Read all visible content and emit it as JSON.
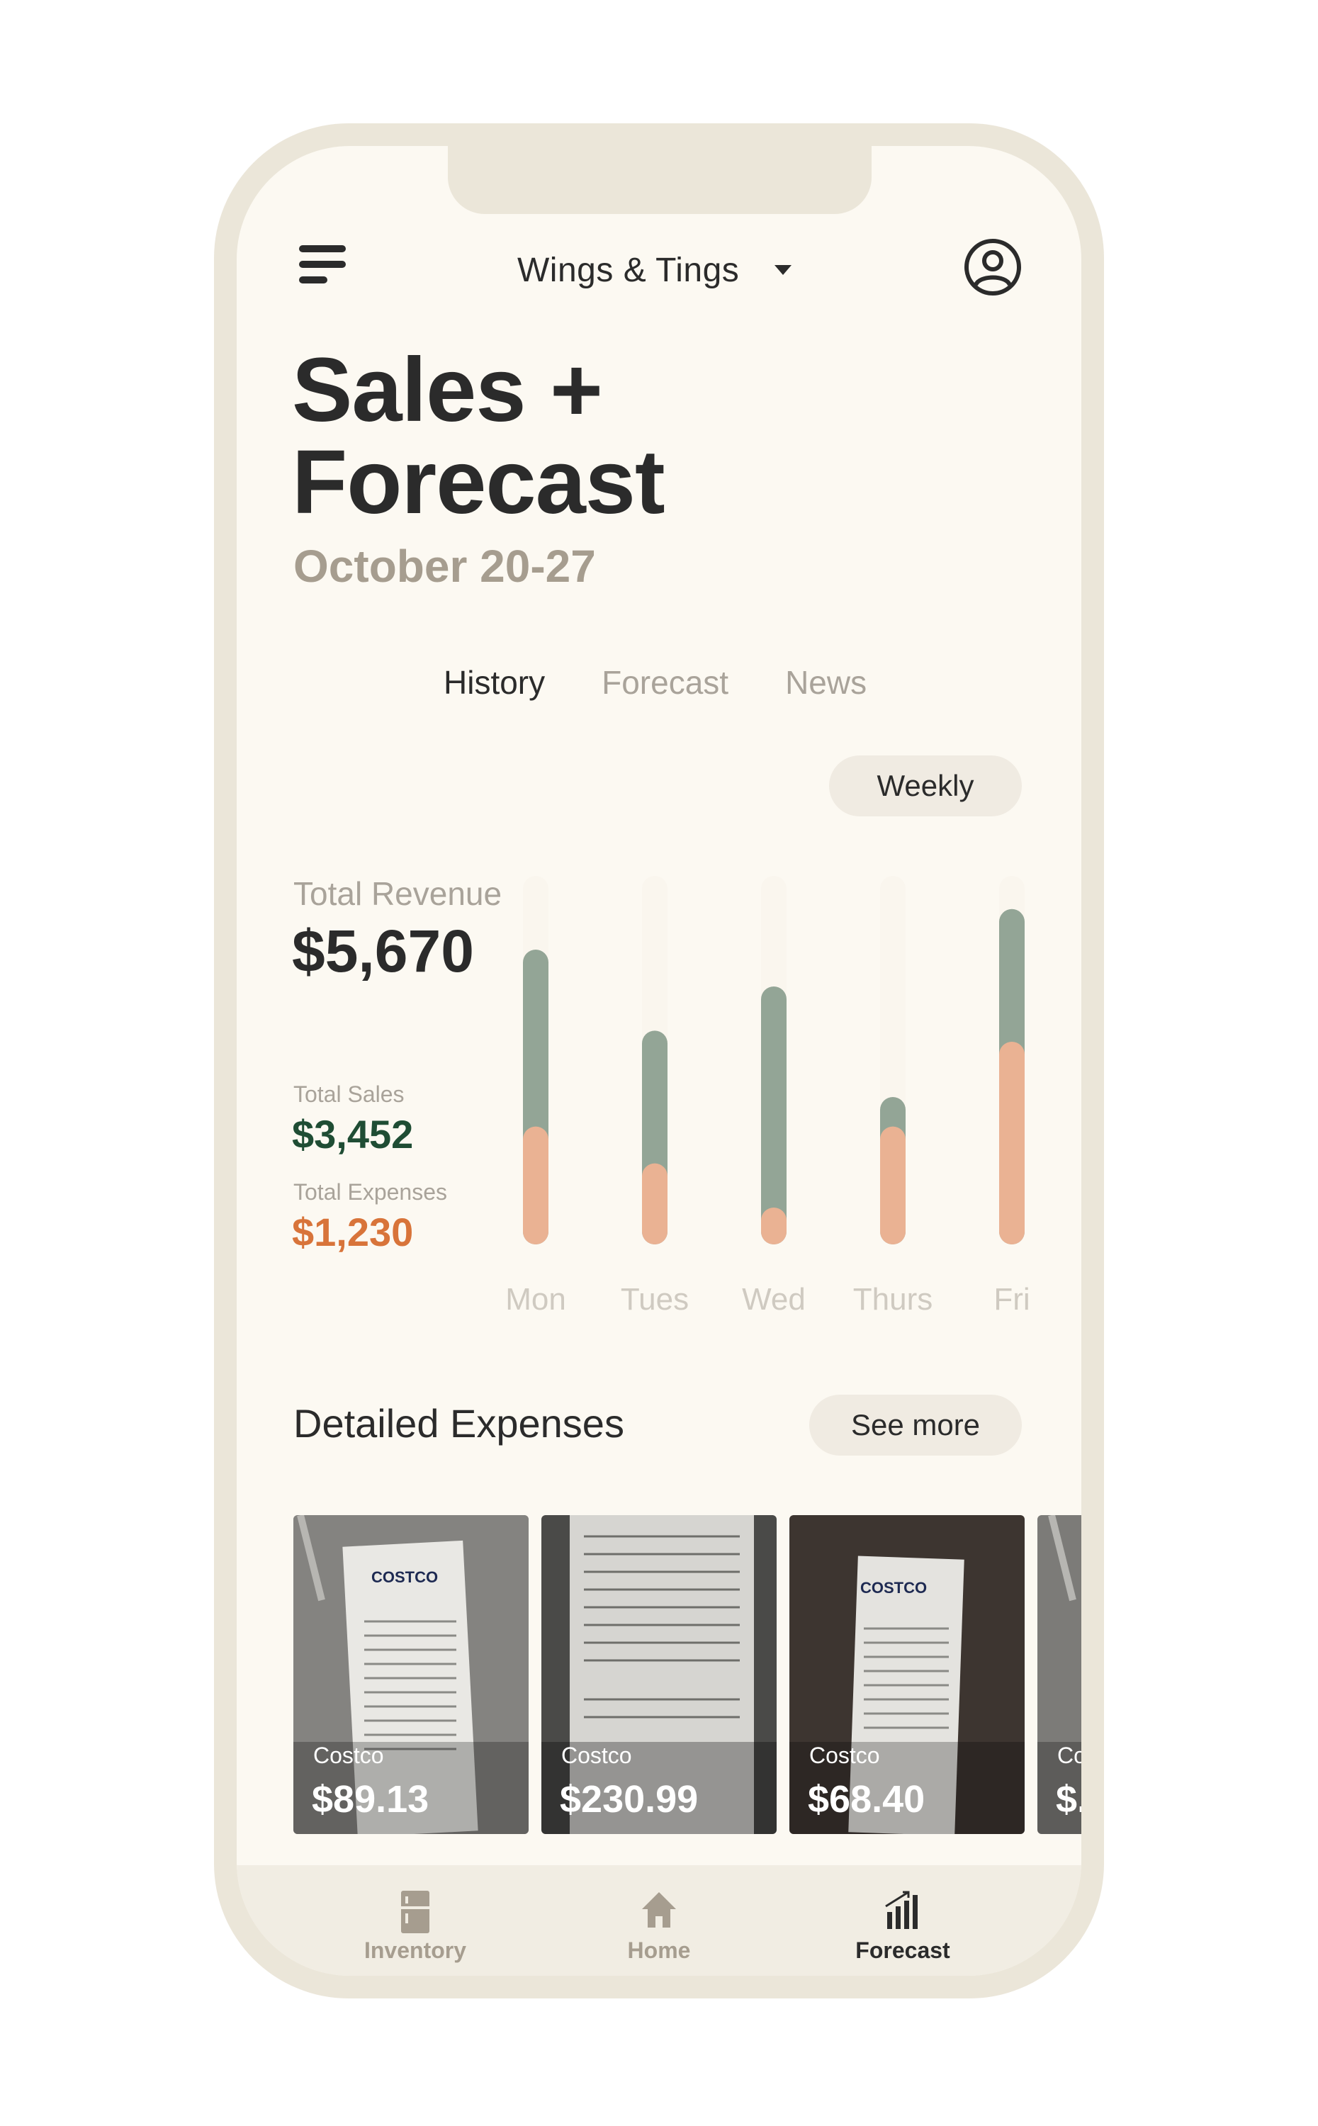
{
  "header": {
    "store_name": "Wings & Tings"
  },
  "page": {
    "title_line1": "Sales +",
    "title_line2": "Forecast",
    "date_range": "October 20-27"
  },
  "tabs": [
    {
      "label": "History",
      "active": true
    },
    {
      "label": "Forecast",
      "active": false
    },
    {
      "label": "News",
      "active": false
    }
  ],
  "period_selector": {
    "value": "Weekly"
  },
  "summary": {
    "total_revenue_label": "Total Revenue",
    "total_revenue": "$5,670",
    "total_sales_label": "Total Sales",
    "total_sales": "$3,452",
    "total_expenses_label": "Total Expenses",
    "total_expenses": "$1,230"
  },
  "chart_data": {
    "type": "bar",
    "stacked": false,
    "categories": [
      "Mon",
      "Tues",
      "Wed",
      "Thurs",
      "Fri"
    ],
    "series": [
      {
        "color": "#93a596",
        "values": [
          0.8,
          0.58,
          0.7,
          0.4,
          0.91
        ]
      },
      {
        "color": "#eab293",
        "values": [
          0.32,
          0.22,
          0.1,
          0.32,
          0.55
        ]
      }
    ],
    "track_color": "#faf6ee",
    "ylim": [
      0,
      1
    ]
  },
  "expenses": {
    "title": "Detailed Expenses",
    "see_more_label": "See more",
    "items": [
      {
        "vendor": "Costco",
        "amount": "$89.13"
      },
      {
        "vendor": "Costco",
        "amount": "$230.99"
      },
      {
        "vendor": "Costco",
        "amount": "$68.40"
      },
      {
        "vendor": "Costco",
        "amount": "$..."
      }
    ]
  },
  "bottom_nav": [
    {
      "label": "Inventory",
      "icon": "fridge-icon",
      "active": false
    },
    {
      "label": "Home",
      "icon": "home-icon",
      "active": false
    },
    {
      "label": "Forecast",
      "icon": "bar-chart-icon",
      "active": true
    }
  ]
}
